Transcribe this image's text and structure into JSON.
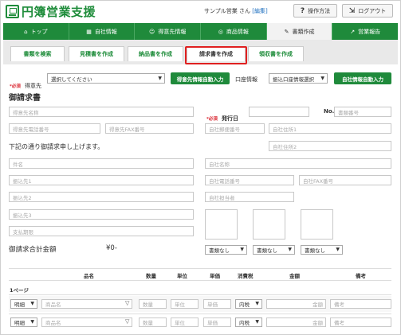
{
  "header": {
    "logo_text": "円簿営業支援",
    "user_name": "サンプル営業",
    "user_suffix": "さん",
    "user_edit": "[編集]",
    "help_icon": "?",
    "help_label": "操作方法",
    "logout_icon": "logout-icon",
    "logout_label": "ログアウト"
  },
  "nav": {
    "items": [
      {
        "icon": "⌂",
        "label": "トップ"
      },
      {
        "icon": "▦",
        "label": "自社情報"
      },
      {
        "icon": "☺",
        "label": "得意先情報"
      },
      {
        "icon": "◎",
        "label": "商品情報"
      },
      {
        "icon": "✎",
        "label": "書類作成"
      },
      {
        "icon": "↗",
        "label": "営業報告"
      }
    ],
    "active_index": 4
  },
  "subtabs": [
    "書類を検索",
    "見積書を作成",
    "納品書を作成",
    "請求書を作成",
    "領収書を作成"
  ],
  "form": {
    "required_label": "*必須",
    "client_label": "得意先",
    "client_select": "選択してください",
    "client_autofill": "得意先情報自動入力",
    "account_label": "口座情報",
    "account_select": "振込口座情報選択",
    "company_autofill": "自社情報自動入力",
    "doc_title": "御請求書",
    "client_name_ph": "得意先名称",
    "issue_required": "*必須",
    "issue_label": "発行日",
    "no_label": "No.",
    "no_ph": "書類番号",
    "client_tel_ph": "得意先電話番号",
    "client_fax_ph": "得意先FAX番号",
    "company_zip_ph": "自社郵便番号",
    "company_addr1_ph": "自社住所1",
    "intro_text": "下記の通り御請求申し上げます。",
    "company_addr2_ph": "自社住所2",
    "subject_ph": "件名",
    "company_name_ph": "自社名称",
    "bank1_ph": "振込先1",
    "company_tel_ph": "自社電話番号",
    "company_fax_ph": "自社FAX番号",
    "bank2_ph": "振込先2",
    "company_rep_ph": "自社担当者",
    "bank3_ph": "振込先3",
    "due_ph": "支払期限",
    "total_label": "御請求合計金額",
    "total_value": "¥0-",
    "stamp_selects": [
      "書類なし",
      "書類なし",
      "書類なし"
    ]
  },
  "table": {
    "headers": [
      "品名",
      "数量",
      "単位",
      "単価",
      "消費税",
      "金額",
      "備考"
    ],
    "page_label": "1ページ",
    "rows": [
      {
        "type": "明細",
        "name_ph": "商品名",
        "qty_ph": "数量",
        "unit_ph": "単位",
        "price_ph": "単価",
        "tax": "内税",
        "amount_ph": "金額",
        "note_ph": "備考"
      },
      {
        "type": "明細",
        "name_ph": "商品名",
        "qty_ph": "数量",
        "unit_ph": "単位",
        "price_ph": "単価",
        "tax": "内税",
        "amount_ph": "金額",
        "note_ph": "備考"
      }
    ]
  },
  "colors": {
    "brand": "#1f8a3b",
    "required": "#d9232d",
    "highlight": "#e02020"
  }
}
